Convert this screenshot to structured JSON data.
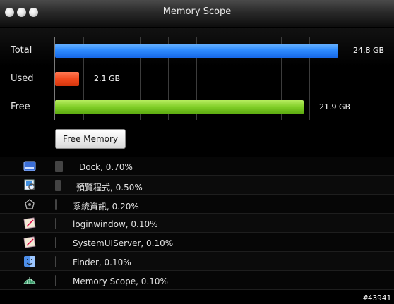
{
  "window": {
    "title": "Memory Scope"
  },
  "memory": {
    "rows": [
      {
        "label": "Total",
        "value": "24.8 GB"
      },
      {
        "label": "Used",
        "value": "2.1 GB"
      },
      {
        "label": "Free",
        "value": "21.9 GB"
      }
    ],
    "button_label": "Free Memory"
  },
  "processes": [
    {
      "name": "Dock",
      "percent": "0.70%",
      "text": "Dock, 0.70%",
      "icon": "dock-icon"
    },
    {
      "name": "預覽程式",
      "percent": "0.50%",
      "text": "預覽程式, 0.50%",
      "icon": "preview-icon"
    },
    {
      "name": "系統資訊",
      "percent": "0.20%",
      "text": "系統資訊, 0.20%",
      "icon": "system-information-icon"
    },
    {
      "name": "loginwindow",
      "percent": "0.10%",
      "text": "loginwindow, 0.10%",
      "icon": "application-icon"
    },
    {
      "name": "SystemUIServer",
      "percent": "0.10%",
      "text": "SystemUIServer, 0.10%",
      "icon": "application-icon"
    },
    {
      "name": "Finder",
      "percent": "0.10%",
      "text": "Finder, 0.10%",
      "icon": "finder-icon"
    },
    {
      "name": "Memory Scope",
      "percent": "0.10%",
      "text": "Memory Scope, 0.10%",
      "icon": "memory-scope-icon"
    }
  ],
  "footer_tag": "#43941"
}
